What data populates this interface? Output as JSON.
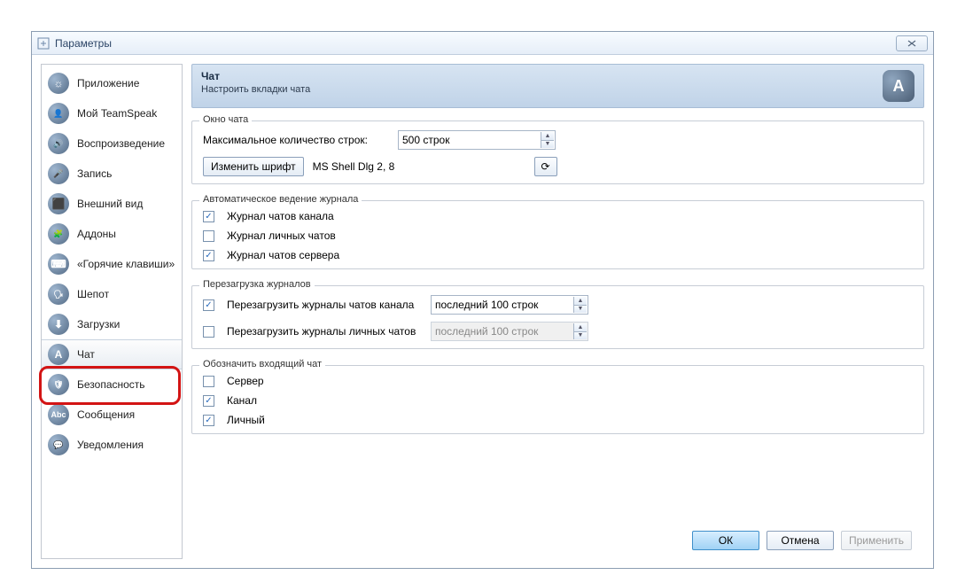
{
  "window": {
    "title": "Параметры"
  },
  "sidebar": {
    "items": [
      {
        "label": "Приложение",
        "glyph": "☼"
      },
      {
        "label": "Мой TeamSpeak",
        "glyph": "👤"
      },
      {
        "label": "Воспроизведение",
        "glyph": "🔊"
      },
      {
        "label": "Запись",
        "glyph": "🎤"
      },
      {
        "label": "Внешний вид",
        "glyph": "⬛"
      },
      {
        "label": "Аддоны",
        "glyph": "🧩"
      },
      {
        "label": "«Горячие клавиши»",
        "glyph": "⌨"
      },
      {
        "label": "Шепот",
        "glyph": "🗣"
      },
      {
        "label": "Загрузки",
        "glyph": "⬇"
      },
      {
        "label": "Чат",
        "glyph": "A"
      },
      {
        "label": "Безопасность",
        "glyph": "🛡"
      },
      {
        "label": "Сообщения",
        "glyph": "Abc"
      },
      {
        "label": "Уведомления",
        "glyph": "💬"
      }
    ],
    "selected_index": 9
  },
  "panel": {
    "title": "Чат",
    "subtitle": "Настроить вкладки чата",
    "icon_letter": "A"
  },
  "chat_window_group": {
    "legend": "Окно чата",
    "max_lines_label": "Максимальное количество строк:",
    "max_lines_value": "500 строк",
    "change_font_button": "Изменить шрифт",
    "font_desc": "MS Shell Dlg 2, 8"
  },
  "logging_group": {
    "legend": "Автоматическое ведение журнала",
    "channel_log": {
      "label": "Журнал чатов канала",
      "checked": true
    },
    "private_log": {
      "label": "Журнал личных чатов",
      "checked": false
    },
    "server_log": {
      "label": "Журнал чатов сервера",
      "checked": true
    }
  },
  "reload_group": {
    "legend": "Перезагрузка журналов",
    "reload_channel": {
      "label": "Перезагрузить журналы чатов канала",
      "checked": true,
      "value": "последний 100 строк"
    },
    "reload_private": {
      "label": "Перезагрузить журналы личных чатов",
      "checked": false,
      "value": "последний 100 строк"
    }
  },
  "incoming_group": {
    "legend": "Обозначить входящий чат",
    "server": {
      "label": "Сервер",
      "checked": false
    },
    "channel": {
      "label": "Канал",
      "checked": true
    },
    "private": {
      "label": "Личный",
      "checked": true
    }
  },
  "footer": {
    "ok": "ОК",
    "cancel": "Отмена",
    "apply": "Применить"
  }
}
